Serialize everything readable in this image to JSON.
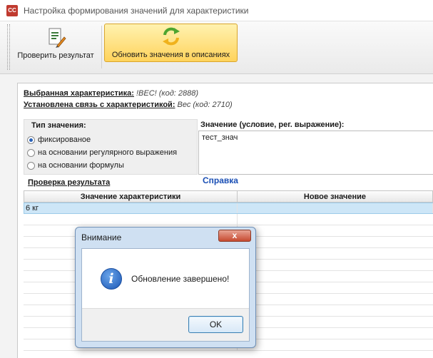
{
  "window": {
    "icon_text": "CC",
    "title": "Настройка формирования значений для характеристики"
  },
  "toolbar": {
    "check_label": "Проверить результат",
    "update_label": "Обновить значения в описаниях"
  },
  "info": {
    "selected_label": "Выбранная характеристика:",
    "selected_value": "!ВЕС! (код: 2888)",
    "link_label": "Установлена связь с характеристикой:",
    "link_value": "Вес (код: 2710)"
  },
  "value_type": {
    "header": "Тип значения:",
    "options": [
      {
        "label": "фиксированое",
        "selected": true
      },
      {
        "label": "на основании регулярного выражения",
        "selected": false
      },
      {
        "label": "на основании формулы",
        "selected": false
      }
    ]
  },
  "value": {
    "header": "Значение (условие, рег. выражение):",
    "text": "тест_знач"
  },
  "help_label": "Справка",
  "check_section_label": "Проверка результата",
  "grid": {
    "columns": [
      "Значение характеристики",
      "Новое значение"
    ],
    "rows": [
      [
        "6 кг",
        ""
      ]
    ]
  },
  "dialog": {
    "title": "Внимание",
    "close_glyph": "x",
    "message": "Обновление завершено!",
    "ok_label": "OK",
    "icon_glyph": "i"
  },
  "colors": {
    "accent": "#ffd35c",
    "link": "#1a4fb5",
    "selection": "#cde6f7"
  }
}
